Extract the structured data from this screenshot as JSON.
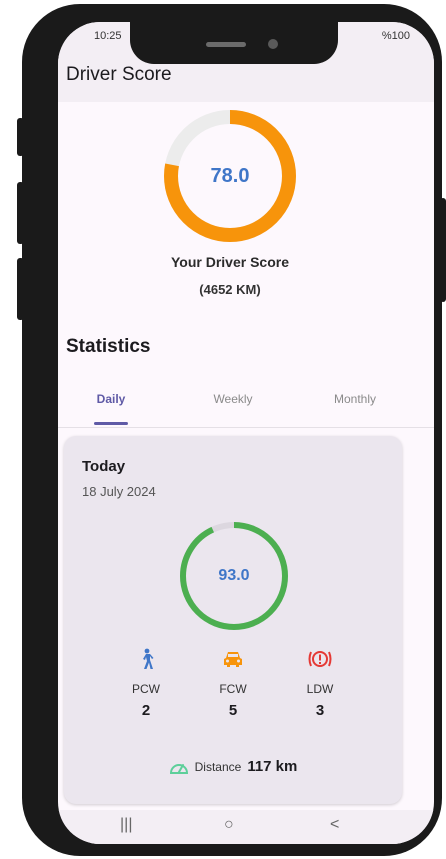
{
  "status_bar": {
    "time": "10:25",
    "right": "%100"
  },
  "app_bar": {
    "title": "Driver Score"
  },
  "score": {
    "value": "78.0",
    "fraction": 0.78,
    "label": "Your Driver Score",
    "km": "(4652 KM)",
    "ring_color": "#f7940b",
    "track_color": "#ececec"
  },
  "statistics": {
    "title": "Statistics",
    "tabs": [
      {
        "label": "Daily",
        "active": true
      },
      {
        "label": "Weekly",
        "active": false
      },
      {
        "label": "Monthly",
        "active": false
      }
    ]
  },
  "daily_card": {
    "title": "Today",
    "date": "18 July 2024",
    "score": "93.0",
    "fraction": 0.93,
    "ring_color": "#4caf50",
    "metrics": [
      {
        "icon": "pedestrian-icon",
        "label": "PCW",
        "value": "2",
        "color": "#3f76c8"
      },
      {
        "icon": "car-icon",
        "label": "FCW",
        "value": "5",
        "color": "#f7940b"
      },
      {
        "icon": "lane-warning-icon",
        "label": "LDW",
        "value": "3",
        "color": "#e53935"
      }
    ],
    "distance": {
      "icon": "speedometer-icon",
      "label": "Distance",
      "value": "117 km",
      "color": "#5dcf9a"
    }
  },
  "nav_bar": {
    "recents": "|||",
    "home": "○",
    "back": "<"
  }
}
